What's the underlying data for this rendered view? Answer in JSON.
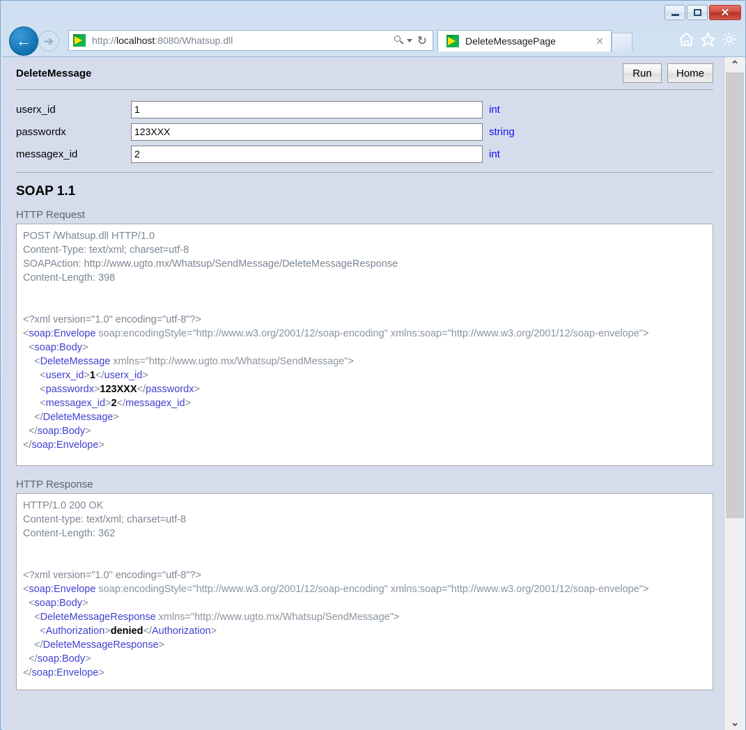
{
  "browser": {
    "window_controls": {
      "minimize": "minimize-button",
      "maximize": "maximize-button",
      "close_glyph": "✕"
    },
    "back_glyph": "←",
    "forward_glyph": "➔",
    "address": {
      "url_scheme": "http://",
      "url_host": "localhost",
      "url_rest": ":8080/Whatsup.dll",
      "full_url": "http://localhost:8080/Whatsup.dll",
      "refresh_glyph": "↻"
    },
    "tab": {
      "title": "DeleteMessagePage",
      "close_glyph": "✕"
    },
    "toolbar_icons": [
      "home-icon",
      "favorites-star-icon",
      "settings-gear-icon"
    ]
  },
  "page": {
    "title": "DeleteMessage",
    "buttons": {
      "run": "Run",
      "home": "Home"
    },
    "form": {
      "rows": [
        {
          "label": "userx_id",
          "value": "1",
          "type": "int"
        },
        {
          "label": "passwordx",
          "value": "123XXX",
          "type": "string"
        },
        {
          "label": "messagex_id",
          "value": "2",
          "type": "int"
        }
      ]
    },
    "soap_heading": "SOAP 1.1",
    "request": {
      "label": "HTTP Request",
      "headers": [
        "POST /Whatsup.dll HTTP/1.0",
        "Content-Type: text/xml; charset=utf-8",
        "SOAPAction: http://www.ugto.mx/Whatsup/SendMessage/DeleteMessageResponse",
        "Content-Length: 398"
      ],
      "xml_decl": "<?xml version=\"1.0\" encoding=\"utf-8\"?>",
      "envelope_open_tag": "soap:Envelope",
      "envelope_attrs": " soap:encodingStyle=\"http://www.w3.org/2001/12/soap-encoding\" xmlns:soap=\"http://www.w3.org/2001/12/soap-envelope\"",
      "body_tag": "soap:Body",
      "method_tag": "DeleteMessage",
      "method_attrs": " xmlns=\"http://www.ugto.mx/Whatsup/SendMessage\"",
      "fields": [
        {
          "tag": "userx_id",
          "value": "1"
        },
        {
          "tag": "passwordx",
          "value": "123XXX"
        },
        {
          "tag": "messagex_id",
          "value": "2"
        }
      ]
    },
    "response": {
      "label": "HTTP Response",
      "headers": [
        "HTTP/1.0 200 OK",
        "Content-type: text/xml; charset=utf-8",
        "Content-Length: 362"
      ],
      "xml_decl": "<?xml version=\"1.0\" encoding=\"utf-8\"?>",
      "envelope_open_tag": "soap:Envelope",
      "envelope_attrs": " soap:encodingStyle=\"http://www.w3.org/2001/12/soap-encoding\" xmlns:soap=\"http://www.w3.org/2001/12/soap-envelope\"",
      "body_tag": "soap:Body",
      "method_tag": "DeleteMessageResponse",
      "method_attrs": " xmlns=\"http://www.ugto.mx/Whatsup/SendMessage\"",
      "fields": [
        {
          "tag": "Authorization",
          "value": "denied"
        }
      ]
    }
  },
  "colors": {
    "chrome_blue": "#cfe0f2",
    "page_background": "#d5dded",
    "tag_blue": "#4040d0",
    "type_blue": "#1010ee",
    "header_gray": "#7b8794"
  },
  "scrollbar": {
    "up_glyph": "⌃",
    "down_glyph": "⌄"
  }
}
